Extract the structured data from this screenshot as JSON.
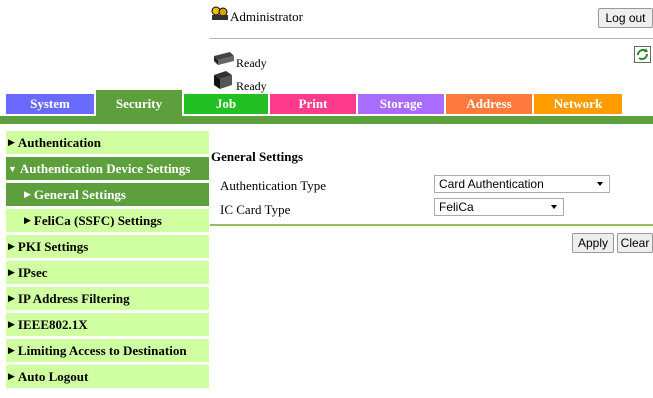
{
  "header": {
    "user": "Administrator",
    "logout_label": "Log out",
    "status_1": "Ready",
    "status_2": "Ready"
  },
  "tabs": [
    {
      "label": "System",
      "color": "#6a6aff"
    },
    {
      "label": "Security",
      "color": "#5c9f3c",
      "active": true
    },
    {
      "label": "Job",
      "color": "#22c022"
    },
    {
      "label": "Print",
      "color": "#ff3c8c"
    },
    {
      "label": "Storage",
      "color": "#a86cff"
    },
    {
      "label": "Address",
      "color": "#ff7a3c"
    },
    {
      "label": "Network",
      "color": "#ff9c00"
    }
  ],
  "sidebar": {
    "items": [
      {
        "label": "Authentication"
      },
      {
        "label": "Authentication Device Settings",
        "expanded": true
      },
      {
        "label": "General Settings",
        "current": true
      },
      {
        "label": "FeliCa (SSFC) Settings"
      },
      {
        "label": "PKI Settings"
      },
      {
        "label": "IPsec"
      },
      {
        "label": "IP Address Filtering"
      },
      {
        "label": "IEEE802.1X"
      },
      {
        "label": "Limiting Access to Destination"
      },
      {
        "label": "Auto Logout"
      }
    ]
  },
  "main": {
    "section_title": "General Settings",
    "auth_type_label": "Authentication Type",
    "auth_type_value": "Card Authentication",
    "ic_card_label": "IC Card Type",
    "ic_card_value": "FeliCa",
    "apply_label": "Apply",
    "clear_label": "Clear"
  },
  "colors": {
    "accent_green": "#5c9f3c",
    "sidebar_bg": "#cfffa0"
  }
}
